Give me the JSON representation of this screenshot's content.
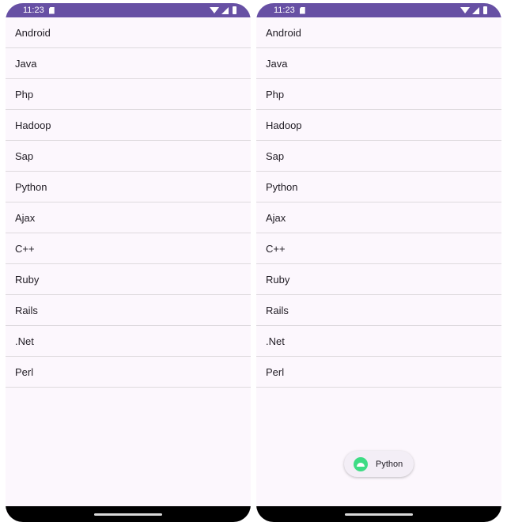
{
  "status_bar": {
    "time": "11:23"
  },
  "items": [
    "Android",
    "Java",
    "Php",
    "Hadoop",
    "Sap",
    "Python",
    "Ajax",
    "C++",
    "Ruby",
    "Rails",
    ".Net",
    "Perl"
  ],
  "toast": {
    "text": "Python"
  },
  "colors": {
    "status_bar": "#6750a4",
    "background": "#fcf7fd",
    "divider": "#dedade",
    "toast_icon": "#3ddc84"
  },
  "icons": {
    "status": [
      "sd-card-icon",
      "wifi-icon",
      "signal-icon",
      "battery-icon"
    ],
    "toast": "android-icon"
  }
}
